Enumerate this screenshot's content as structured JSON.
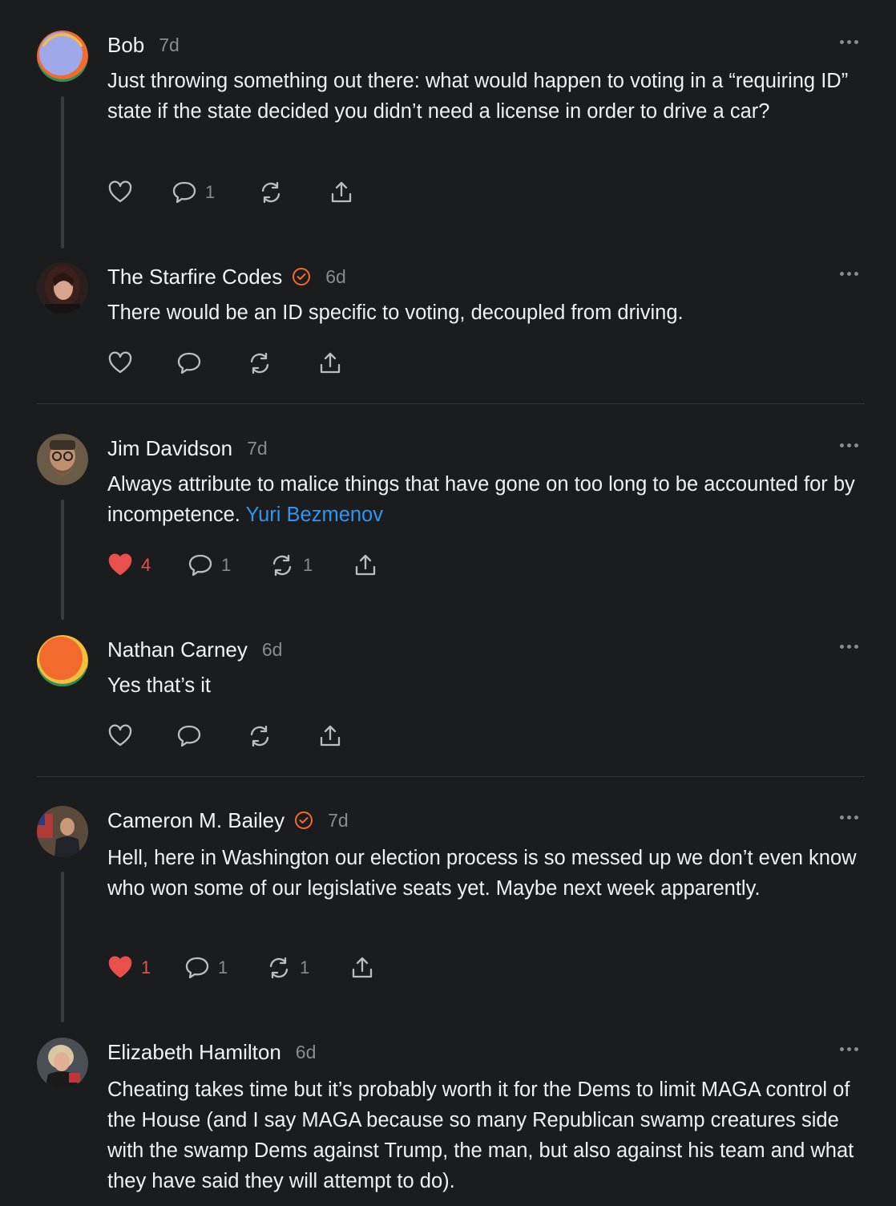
{
  "posts": [
    {
      "name": "Bob",
      "time": "7d",
      "verified": false,
      "text": "Just throwing something out there: what would happen to voting in a “requiring ID” state if the state decided you didn’t need a license in order to drive a car?",
      "likes": "",
      "comments": "1",
      "restacks": ""
    },
    {
      "name": "The Starfire Codes",
      "time": "6d",
      "verified": true,
      "text": "There would be an ID specific to voting, decoupled from driving.",
      "likes": "",
      "comments": "",
      "restacks": ""
    },
    {
      "name": "Jim Davidson",
      "time": "7d",
      "verified": false,
      "text": "Always attribute to malice things that have gone on too long to be accounted for by incompetence. ",
      "link": "Yuri Bezmenov",
      "likes": "4",
      "comments": "1",
      "restacks": "1",
      "liked": true
    },
    {
      "name": "Nathan Carney",
      "time": "6d",
      "verified": false,
      "text": "Yes that’s it",
      "likes": "",
      "comments": "",
      "restacks": ""
    },
    {
      "name": "Cameron M. Bailey",
      "time": "7d",
      "verified": true,
      "text": "Hell, here in Washington our election process is so messed up we don’t even know who won some of our legislative seats yet. Maybe next week apparently.",
      "likes": "1",
      "comments": "1",
      "restacks": "1",
      "liked": true
    },
    {
      "name": "Elizabeth Hamilton",
      "time": "6d",
      "verified": false,
      "text": "Cheating takes time but it’s probably worth it for the Dems to limit MAGA control of the House (and I say MAGA because so many Republican swamp creatures side with the swamp Dems against Trump, the man, but also against his team and what they have said they will attempt to do)."
    }
  ],
  "colors": {
    "accent_verified": "#f26a2e",
    "liked": "#e8504d",
    "link": "#2f95f0"
  },
  "icons": [
    "heart-icon",
    "comment-icon",
    "restack-icon",
    "share-icon",
    "more-icon",
    "verified-badge-icon"
  ]
}
